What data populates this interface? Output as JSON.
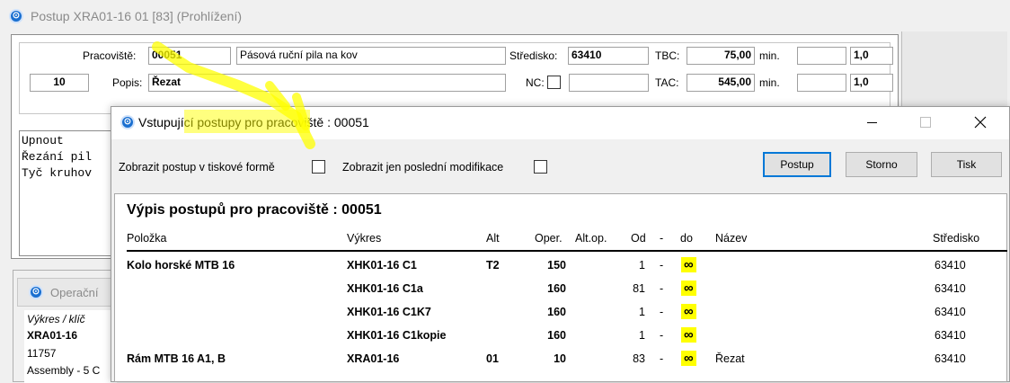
{
  "main_window": {
    "title": "Postup XRA01-16 01 [83] (Prohlížení)",
    "pracoviste_label": "Pracoviště:",
    "pracoviste_value": "00051",
    "pracoviste_name": "Pásová ruční pila na kov",
    "stredisko_label": "Středisko:",
    "stredisko_value": "63410",
    "tbc_label": "TBC:",
    "tbc_value": "75,00",
    "tbc_unit": "min.",
    "tbc_factor": "1,0",
    "op_number": "10",
    "popis_label": "Popis:",
    "popis_value": "Řezat",
    "nc_label": "NC:",
    "tac_label": "TAC:",
    "tac_value": "545,00",
    "tac_unit": "min.",
    "tac_factor": "1,0",
    "notes_lines": [
      "Upnout",
      "Řezání pil",
      "Tyč kruhov"
    ],
    "operacni_panel_title": "Operační",
    "side_list": {
      "header": "Výkres / klíč",
      "rows": [
        "XRA01-16",
        "11757",
        "Assembly - 5 C"
      ]
    }
  },
  "dialog": {
    "title": "Vstupující postupy pro  pracoviště : 00051",
    "print_form_label": "Zobrazit postup v tiskové formě",
    "last_mod_label": "Zobrazit jen poslední modifikace",
    "buttons": {
      "postup": "Postup",
      "storno": "Storno",
      "tisk": "Tisk"
    },
    "report_title": "Výpis postupů pro pracoviště : 00051",
    "columns": {
      "polozka": "Položka",
      "vykres": "Výkres",
      "alt": "Alt",
      "oper": "Oper.",
      "altop": "Alt.op.",
      "od": "Od",
      "dash": "-",
      "do": "do",
      "nazev": "Název",
      "stredisko": "Středisko"
    },
    "rows": [
      {
        "polozka": "Kolo horské MTB 16",
        "vykres": "XHK01-16 C1",
        "alt": "T2",
        "oper": "150",
        "od": "1",
        "dash": "-",
        "do": "∞",
        "nazev": "",
        "stredisko": "63410"
      },
      {
        "polozka": "",
        "vykres": "XHK01-16 C1a",
        "alt": "",
        "oper": "160",
        "od": "81",
        "dash": "-",
        "do": "∞",
        "nazev": "",
        "stredisko": "63410"
      },
      {
        "polozka": "",
        "vykres": "XHK01-16 C1K7",
        "alt": "",
        "oper": "160",
        "od": "1",
        "dash": "-",
        "do": "∞",
        "nazev": "",
        "stredisko": "63410"
      },
      {
        "polozka": "",
        "vykres": "XHK01-16 C1kopie",
        "alt": "",
        "oper": "160",
        "od": "1",
        "dash": "-",
        "do": "∞",
        "nazev": "",
        "stredisko": "63410"
      },
      {
        "polozka": "Rám MTB 16 A1, B",
        "vykres": "XRA01-16",
        "alt": "01",
        "oper": "10",
        "od": "83",
        "dash": "-",
        "do": "∞",
        "nazev": "Řezat",
        "stredisko": "63410"
      }
    ]
  }
}
